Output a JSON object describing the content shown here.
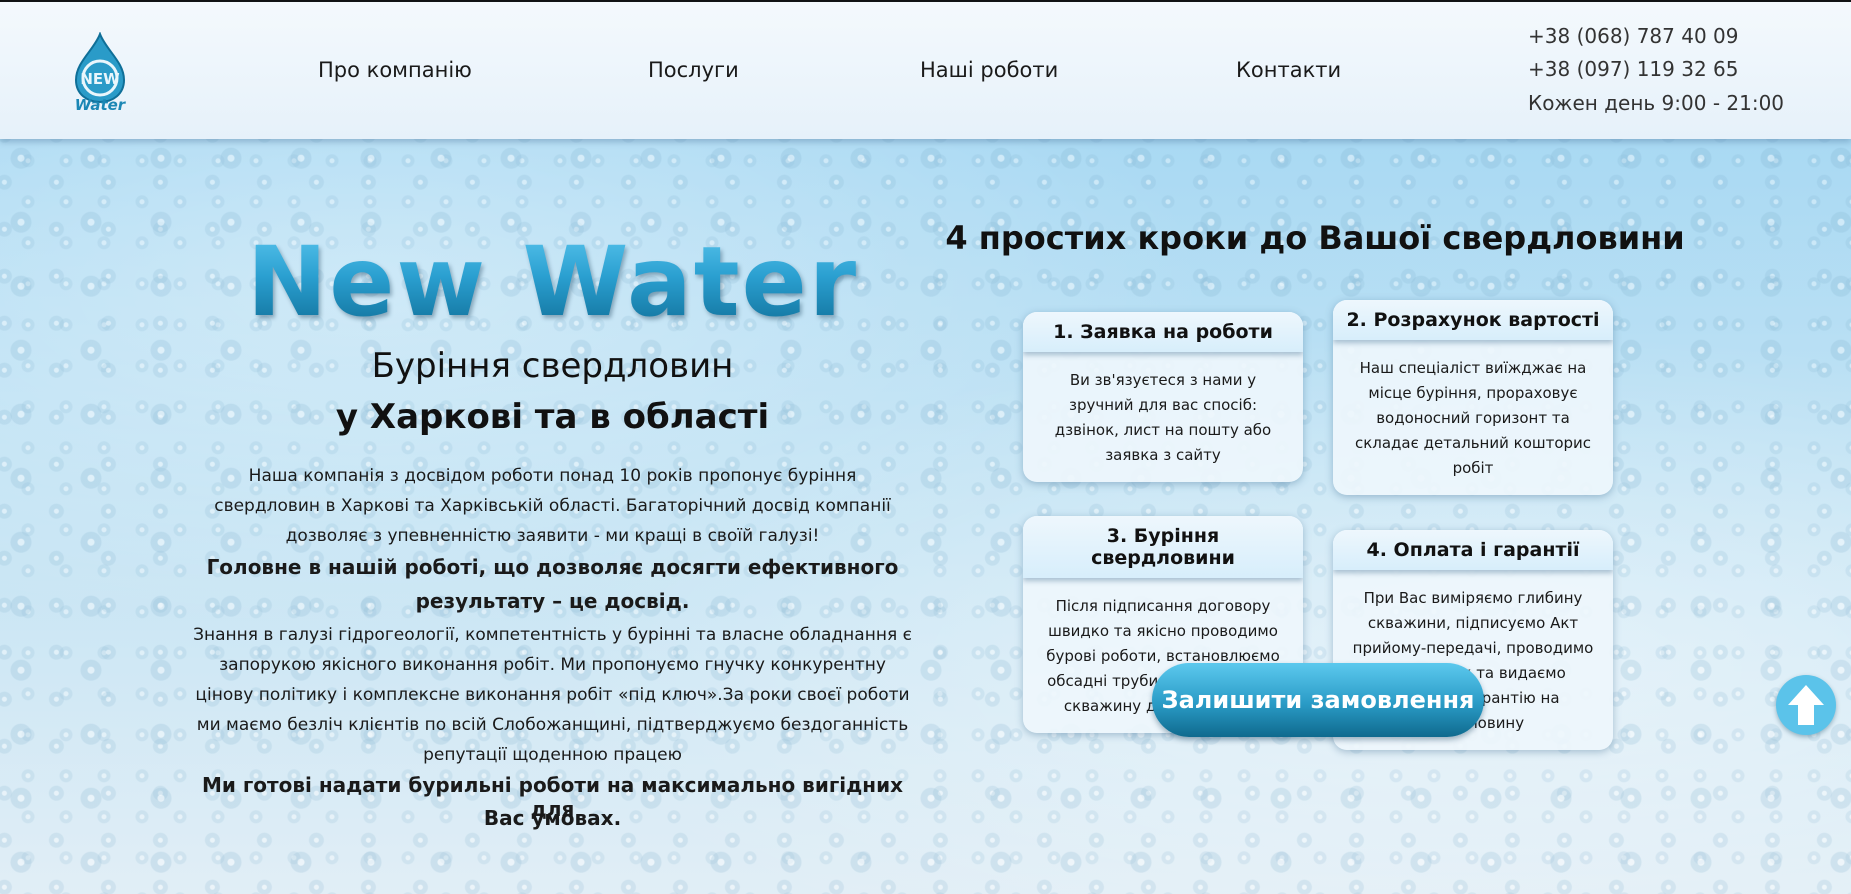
{
  "brand": {
    "logo_text": "Water",
    "logo_mark": "NEW",
    "logo_icon": "water-drop-icon",
    "color_primary": "#1b87b5",
    "color_light": "#5cc8f0"
  },
  "nav": {
    "items": [
      {
        "label": "Про компанію"
      },
      {
        "label": "Послуги"
      },
      {
        "label": "Наші роботи"
      },
      {
        "label": "Контакти"
      }
    ]
  },
  "contacts": {
    "phone1": "+38 (068) 787 40 09",
    "phone2": "+38 (097) 119 32 65",
    "hours": "Кожен день 9:00 - 21:00"
  },
  "hero": {
    "title": "New Water",
    "subtitle_line1": "Буріння свердловин",
    "subtitle_line2": "у Харкові та в області",
    "description": [
      {
        "text": "Наша компанія з досвідом роботи понад 10 років пропонує буріння",
        "bold": false
      },
      {
        "text": "свердловин в Харкові та Харківській області. Багаторічний досвід компанії",
        "bold": false
      },
      {
        "text": "дозволяє з упевненністю заявити - ми кращі в своїй галузі!",
        "bold": false
      },
      {
        "text": "Головне в нашій роботі, що дозволяє досягти ефективного",
        "bold": true
      },
      {
        "text": "результату – це досвід.",
        "bold": true
      },
      {
        "text": "Знання в галузі гідрогеології, компетентність у бурінні та власне обладнання є",
        "bold": false
      },
      {
        "text": "запорукою якісного виконання робіт. Ми пропонуємо гнучку конкурентну",
        "bold": false
      },
      {
        "text": "цінову політику і комплексне виконання робіт «під ключ».За роки своєї роботи",
        "bold": false
      },
      {
        "text": "ми маємо безліч клієнтів по всій Слобожанщині,  підтверджуємо бездоганність",
        "bold": false
      },
      {
        "text": "репутації щоденною працею",
        "bold": false
      },
      {
        "text": "Ми готові надати бурильні роботи на максимально вигідних для",
        "bold": true
      },
      {
        "text": "Вас умовах.",
        "bold": true
      }
    ]
  },
  "steps": {
    "title": "4 простих кроки до Вашої свердловини",
    "items": [
      {
        "title": "1. Заявка на роботи",
        "text": "Ви зв'язуєтеся з нами у зручний для вас спосіб: дзвінок, лист на пошту або заявка з сайту"
      },
      {
        "title": "2. Розрахунок вартості",
        "text": "Наш спеціаліст виїжджає на місце буріння, прораховує водоносний горизонт та складає детальний кошторис робіт"
      },
      {
        "title": "3. Буріння свердловини",
        "text": "Після підписання договору швидко та якісно проводимо бурові роботи, встановлюємо обсадні труби та прокачуємо скважину до чистої води"
      },
      {
        "title": "4. Оплата і гарантії",
        "text": "При Вас виміряємо глибину скважини, підписуємо Акт прийому-передачі, проводимо розрахунок та видаємо паспорт і гарантію на свердловину"
      }
    ]
  },
  "cta": {
    "label": "Залишити замовлення"
  },
  "scroll_top": {
    "icon": "arrow-up-icon"
  }
}
